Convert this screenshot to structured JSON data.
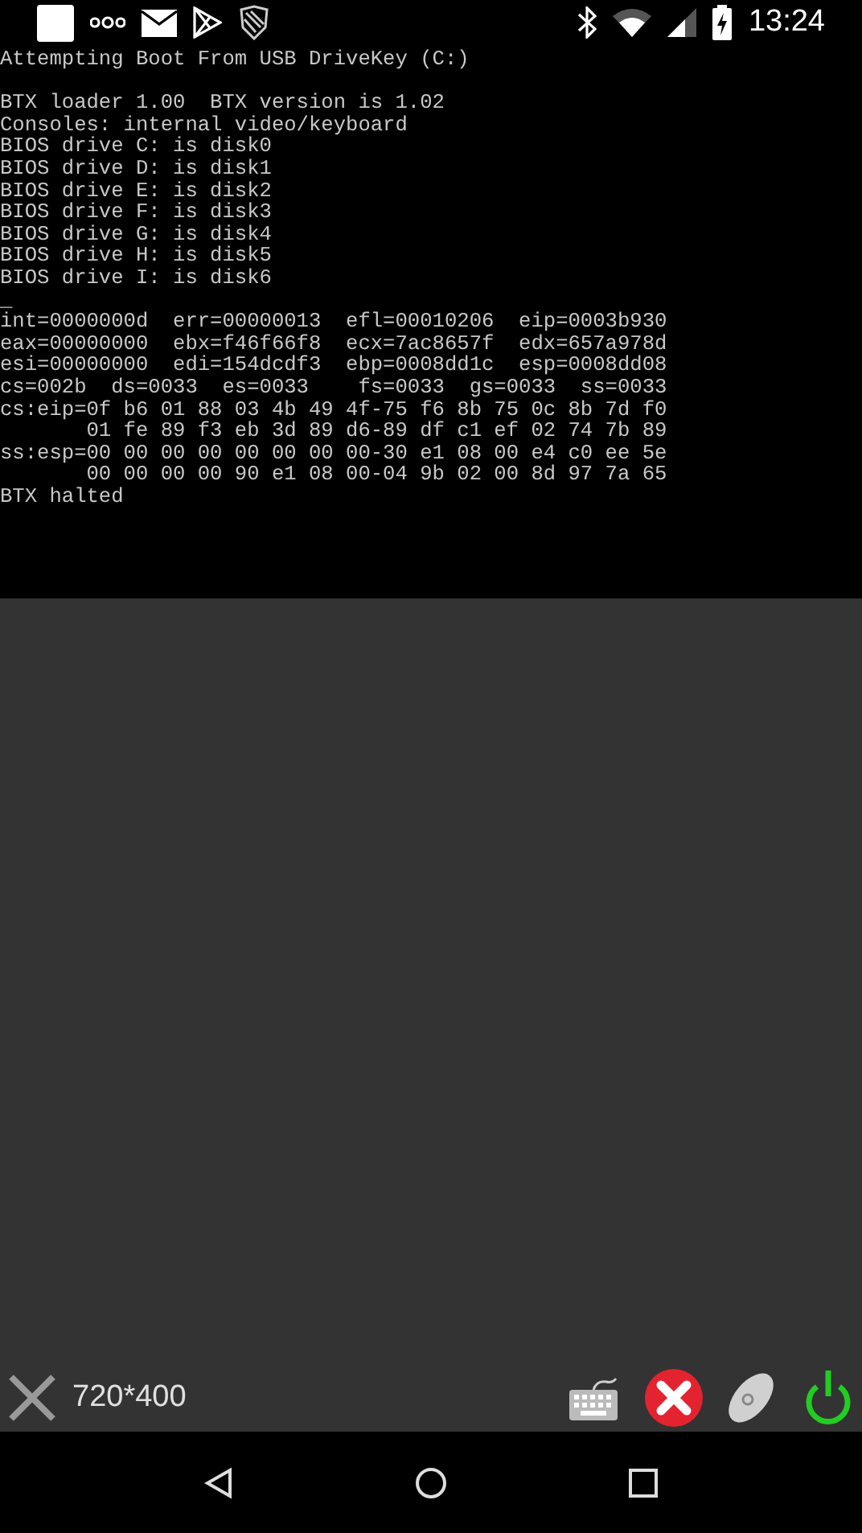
{
  "status_bar": {
    "time": "13:24"
  },
  "terminal": {
    "blocks": [
      [
        "Attempting Boot From USB DriveKey (C:)"
      ],
      [
        "BTX loader 1.00  BTX version is 1.02",
        "Consoles: internal video/keyboard",
        "BIOS drive C: is disk0",
        "BIOS drive D: is disk1",
        "BIOS drive E: is disk2",
        "BIOS drive F: is disk3",
        "BIOS drive G: is disk4",
        "BIOS drive H: is disk5",
        "BIOS drive I: is disk6",
        "_",
        "int=0000000d  err=00000013  efl=00010206  eip=0003b930",
        "eax=00000000  ebx=f46f66f8  ecx=7ac8657f  edx=657a978d",
        "esi=00000000  edi=154dcdf3  ebp=0008dd1c  esp=0008dd08",
        "cs=002b  ds=0033  es=0033    fs=0033  gs=0033  ss=0033",
        "cs:eip=0f b6 01 88 03 4b 49 4f-75 f6 8b 75 0c 8b 7d f0",
        "       01 fe 89 f3 eb 3d 89 d6-89 df c1 ef 02 74 7b 89",
        "ss:esp=00 00 00 00 00 00 00 00-30 e1 08 00 e4 c0 ee 5e",
        "       00 00 00 00 90 e1 08 00-04 9b 02 00 8d 97 7a 65",
        "BTX halted"
      ]
    ]
  },
  "toolbar": {
    "resolution": "720*400"
  }
}
